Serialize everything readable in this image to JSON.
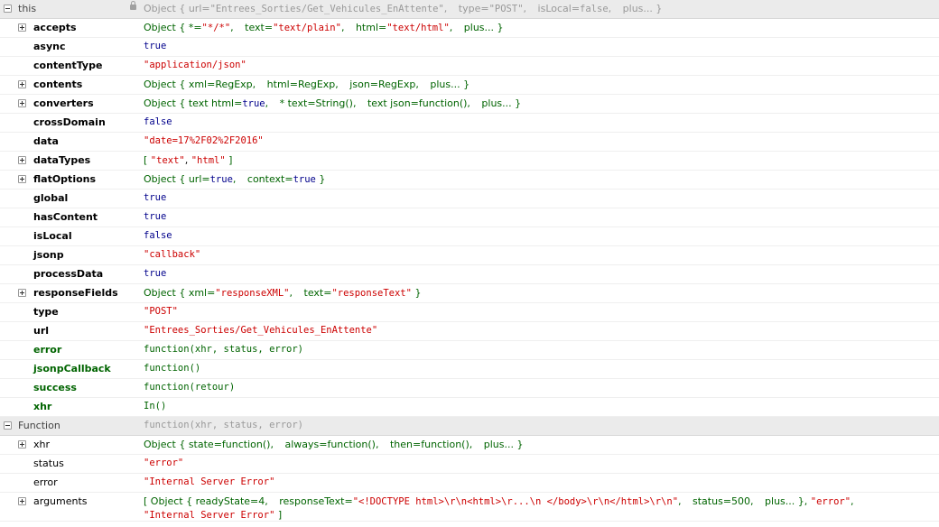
{
  "scope_this": {
    "name": "this",
    "summary": {
      "title": "Object {",
      "url_key": "url=",
      "url_val": "\"Entrees_Sorties/Get_Vehicules_EnAttente\"",
      "type_key": "type=",
      "type_val": "\"POST\"",
      "local_key": "isLocal=",
      "local_val": "false",
      "more": "plus...",
      "close": "}"
    }
  },
  "accepts": {
    "name": "accepts",
    "title": "Object {",
    "k1": "*=",
    "v1": "\"*/*\"",
    "k2": "text=",
    "v2": "\"text/plain\"",
    "k3": "html=",
    "v3": "\"text/html\"",
    "more": "plus...",
    "close": "}"
  },
  "async": {
    "name": "async",
    "value": "true"
  },
  "contentType": {
    "name": "contentType",
    "value": "\"application/json\""
  },
  "contents": {
    "name": "contents",
    "title": "Object {",
    "k1": "xml=",
    "v1": "RegExp",
    "k2": "html=",
    "v2": "RegExp",
    "k3": "json=",
    "v3": "RegExp",
    "more": "plus...",
    "close": "}"
  },
  "converters": {
    "name": "converters",
    "title": "Object {",
    "k1": "text html=",
    "v1": "true",
    "k2": "* text=",
    "v2": "String()",
    "k3": "text json=",
    "v3": "function()",
    "more": "plus...",
    "close": "}"
  },
  "crossDomain": {
    "name": "crossDomain",
    "value": "false"
  },
  "data": {
    "name": "data",
    "value": "\"date=17%2F02%2F2016\""
  },
  "dataTypes": {
    "name": "dataTypes",
    "open": "[",
    "v1": "\"text\"",
    "v2": "\"html\"",
    "close": "]"
  },
  "flatOptions": {
    "name": "flatOptions",
    "title": "Object {",
    "k1": "url=",
    "v1": "true",
    "k2": "context=",
    "v2": "true",
    "close": "}"
  },
  "global": {
    "name": "global",
    "value": "true"
  },
  "hasContent": {
    "name": "hasContent",
    "value": "true"
  },
  "isLocal": {
    "name": "isLocal",
    "value": "false"
  },
  "jsonp": {
    "name": "jsonp",
    "value": "\"callback\""
  },
  "processData": {
    "name": "processData",
    "value": "true"
  },
  "responseFields": {
    "name": "responseFields",
    "title": "Object {",
    "k1": "xml=",
    "v1": "\"responseXML\"",
    "k2": "text=",
    "v2": "\"responseText\"",
    "close": "}"
  },
  "type": {
    "name": "type",
    "value": "\"POST\""
  },
  "url": {
    "name": "url",
    "value": "\"Entrees_Sorties/Get_Vehicules_EnAttente\""
  },
  "error": {
    "name": "error",
    "value": "function(xhr, status, error)"
  },
  "jsonpCallback": {
    "name": "jsonpCallback",
    "value": "function()"
  },
  "success": {
    "name": "success",
    "value": "function(retour)"
  },
  "xhr": {
    "name": "xhr",
    "value": "In()"
  },
  "scope_function": {
    "name": "Function",
    "summary": "function(xhr, status, error)"
  },
  "fxhr": {
    "name": "xhr",
    "title": "Object {",
    "k1": "state=",
    "v1": "function()",
    "k2": "always=",
    "v2": "function()",
    "k3": "then=",
    "v3": "function()",
    "more": "plus...",
    "close": "}"
  },
  "fstatus": {
    "name": "status",
    "value": "\"error\""
  },
  "ferror": {
    "name": "error",
    "value": "\"Internal Server Error\""
  },
  "arguments": {
    "name": "arguments",
    "open": "[",
    "title": "Object {",
    "k1": "readyState=",
    "v1": "4",
    "k2": "responseText=",
    "v2": "\"<!DOCTYPE html>\\r\\n<html>\\r...\\n     </body>\\r\\n</html>\\r\\n\"",
    "k3": "status=",
    "v3": "500",
    "more": "plus...",
    "objclose": "}",
    "s1": "\"error\"",
    "s2": "\"Internal Server Error\"",
    "close": "]"
  }
}
